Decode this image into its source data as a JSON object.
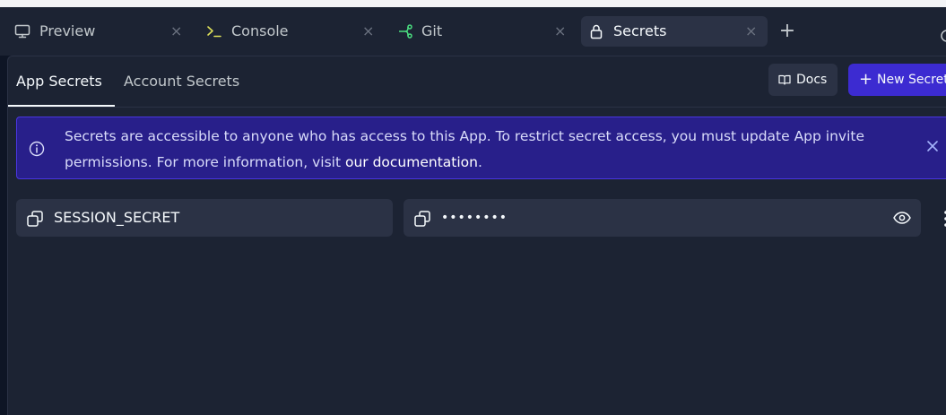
{
  "tabs": [
    {
      "label": "Preview",
      "icon": "monitor-icon",
      "active": false
    },
    {
      "label": "Console",
      "icon": "terminal-icon",
      "active": false
    },
    {
      "label": "Git",
      "icon": "git-branch-icon",
      "active": false
    },
    {
      "label": "Secrets",
      "icon": "lock-icon",
      "active": true
    }
  ],
  "tab_close_glyph": "×",
  "add_tab_glyph": "+",
  "subtabs": {
    "app": "App Secrets",
    "account": "Account Secrets"
  },
  "toolbar": {
    "docs_label": "Docs",
    "new_secret_label": "New Secret",
    "new_secret_plus": "+"
  },
  "banner": {
    "message": "Secrets are accessible to anyone who has access to this App. To restrict secret access, you must update App invite permissions. For more information, visit ",
    "link_text": "our documentation",
    "message_end": "."
  },
  "secrets": [
    {
      "key": "SESSION_SECRET",
      "value_masked": "••••••••"
    }
  ],
  "colors": {
    "background": "#0e1525",
    "surface": "#1c2333",
    "surface_raised": "#2b3245",
    "accent": "#3c2bd1",
    "banner_bg": "#281f8a",
    "banner_border": "#4936e0",
    "console_icon": "#e0e25a",
    "git_icon": "#4ade80"
  }
}
